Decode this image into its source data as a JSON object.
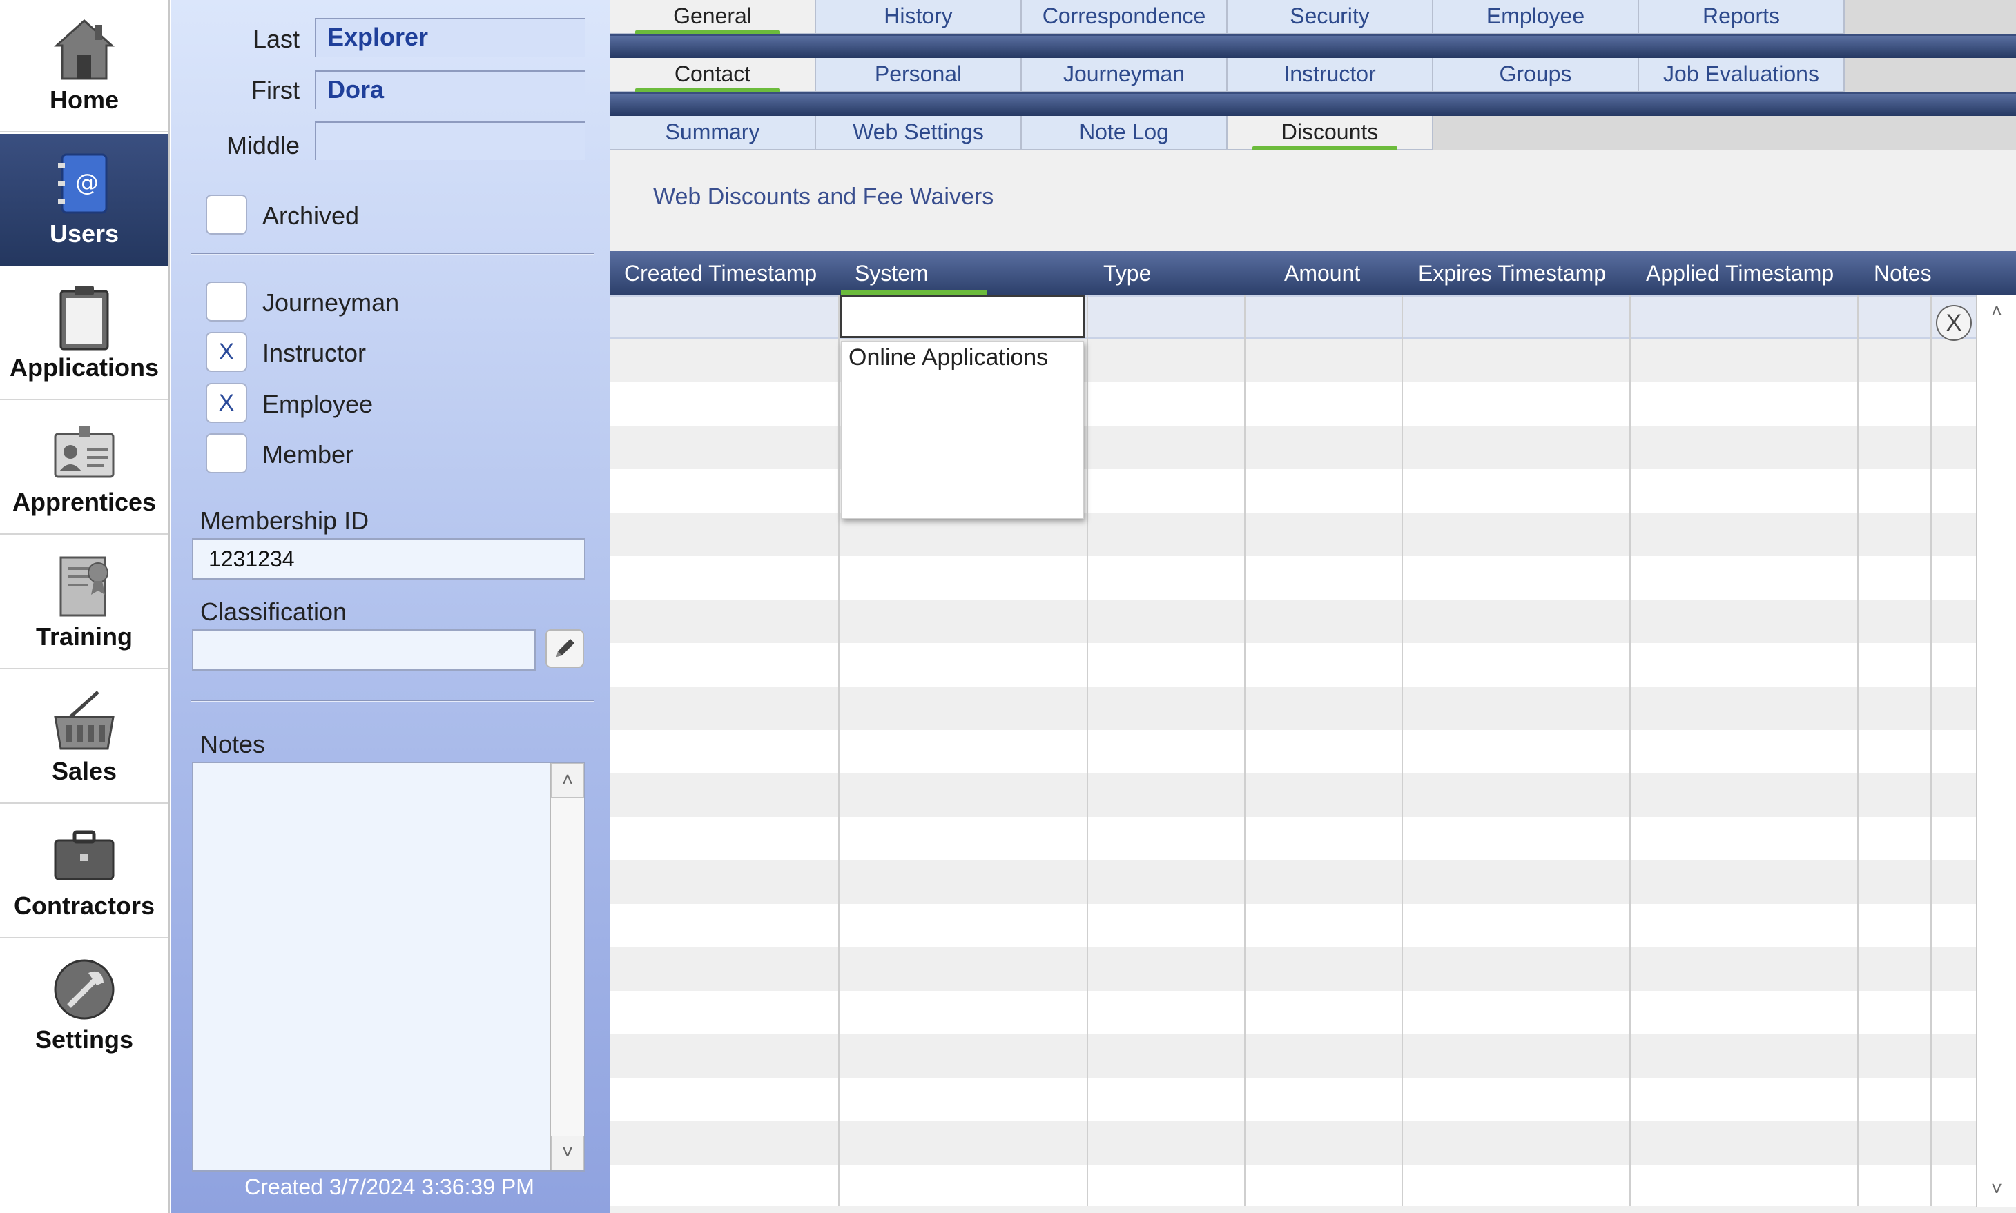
{
  "nav": {
    "items": [
      {
        "label": "Home",
        "icon": "home-icon"
      },
      {
        "label": "Users",
        "icon": "address-book-icon",
        "active": true
      },
      {
        "label": "Applications",
        "icon": "clipboard-icon"
      },
      {
        "label": "Apprentices",
        "icon": "id-badge-icon"
      },
      {
        "label": "Training",
        "icon": "certificate-icon"
      },
      {
        "label": "Sales",
        "icon": "shopping-basket-icon"
      },
      {
        "label": "Contractors",
        "icon": "briefcase-icon"
      },
      {
        "label": "Settings",
        "icon": "tools-icon"
      }
    ]
  },
  "person": {
    "last_label": "Last",
    "last_value": "Explorer",
    "first_label": "First",
    "first_value": "Dora",
    "middle_label": "Middle",
    "middle_value": "",
    "archived_label": "Archived",
    "archived_checked": false,
    "roles": [
      {
        "label": "Journeyman",
        "checked": false,
        "mark": ""
      },
      {
        "label": "Instructor",
        "checked": true,
        "mark": "X"
      },
      {
        "label": "Employee",
        "checked": true,
        "mark": "X"
      },
      {
        "label": "Member",
        "checked": false,
        "mark": ""
      }
    ],
    "membership_label": "Membership ID",
    "membership_value": "1231234",
    "classification_label": "Classification",
    "classification_value": "",
    "notes_label": "Notes",
    "notes_value": "",
    "created": "Created 3/7/2024 3:36:39 PM"
  },
  "tabs": {
    "row1": [
      "General",
      "History",
      "Correspondence",
      "Security",
      "Employee",
      "Reports"
    ],
    "row1_active": "General",
    "row2": [
      "Contact",
      "Personal",
      "Journeyman",
      "Instructor",
      "Groups",
      "Job Evaluations"
    ],
    "row2_active": "Contact",
    "row3": [
      "Summary",
      "Web Settings",
      "Note Log",
      "Discounts"
    ],
    "row3_active": "Discounts"
  },
  "discounts": {
    "title": "Web Discounts and Fee Waivers",
    "columns": [
      "Created Timestamp",
      "System",
      "Type",
      "Amount",
      "Expires Timestamp",
      "Applied Timestamp",
      "Notes"
    ],
    "sort_column": "System",
    "delete_label": "X",
    "system_input_value": "",
    "dropdown_options": [
      "Online Applications"
    ]
  },
  "colors": {
    "accent_green": "#6cbb3c",
    "header_blue": "#2c3f6a",
    "link_blue": "#2e4a8c"
  }
}
